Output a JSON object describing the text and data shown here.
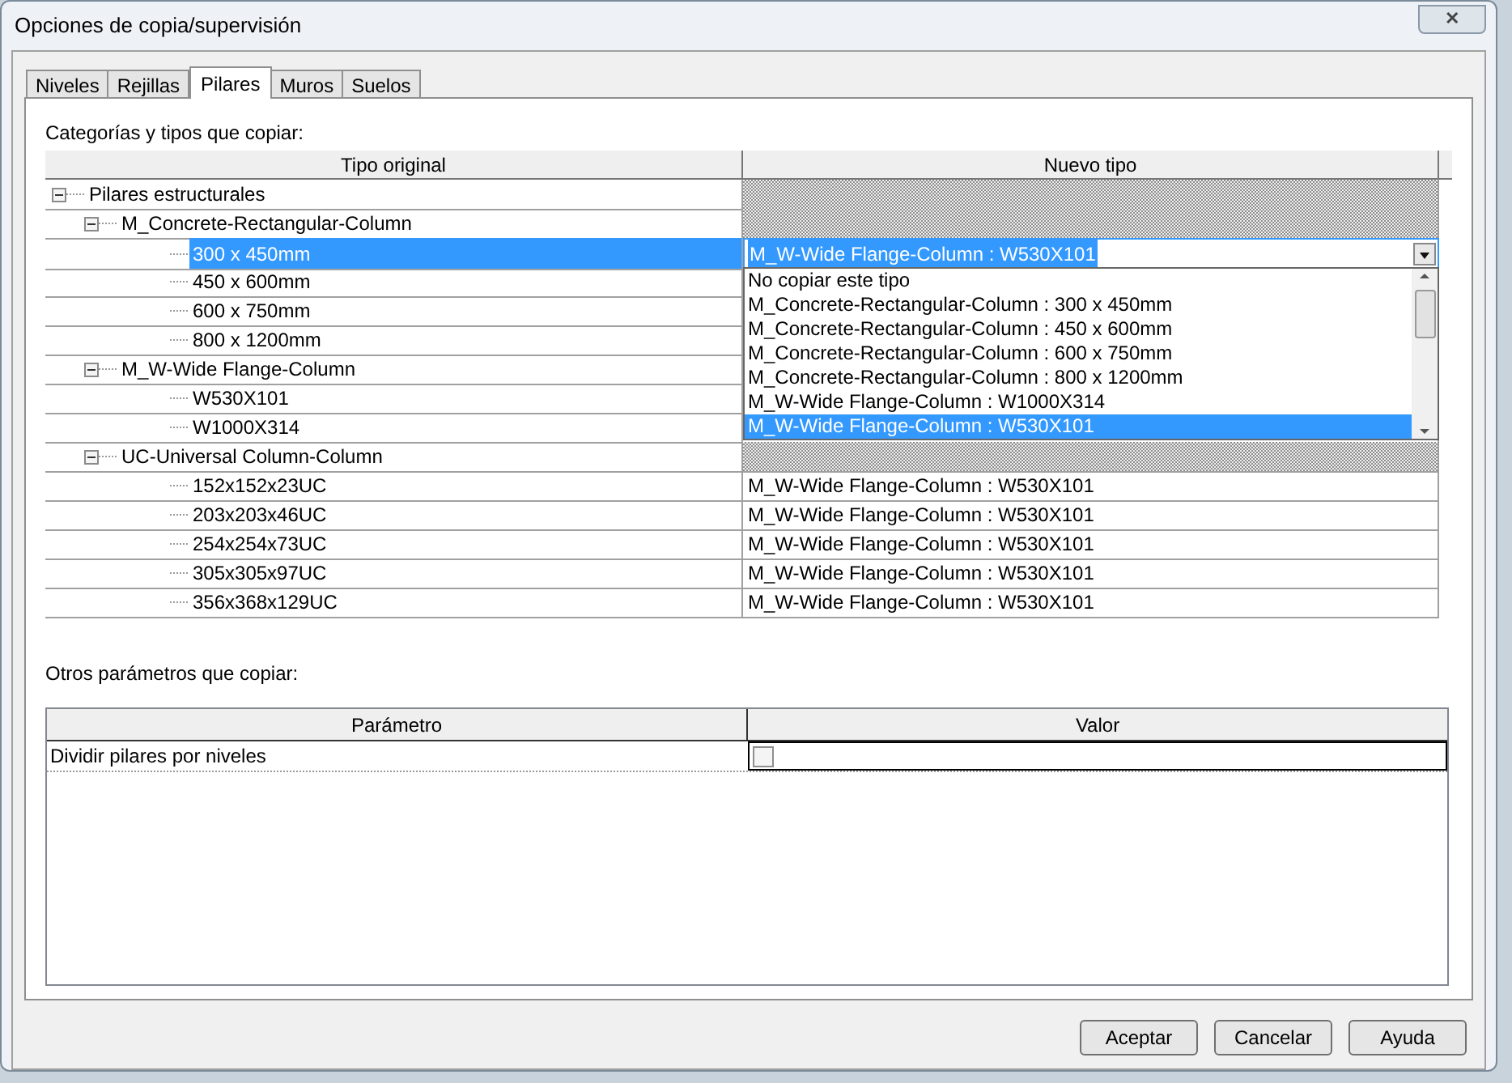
{
  "window": {
    "title": "Opciones de copia/supervisión",
    "close": "✕"
  },
  "tabs": [
    {
      "label": "Niveles",
      "selected": false
    },
    {
      "label": "Rejillas",
      "selected": false
    },
    {
      "label": "Pilares",
      "selected": true
    },
    {
      "label": "Muros",
      "selected": false
    },
    {
      "label": "Suelos",
      "selected": false
    }
  ],
  "types_section": {
    "label": "Categorías y tipos que copiar:",
    "columns": [
      "Tipo original",
      "Nuevo tipo"
    ],
    "tree": [
      {
        "label": "Pilares estructurales",
        "expanded": true,
        "children": [
          {
            "label": "M_Concrete-Rectangular-Column",
            "expanded": true,
            "children": [
              {
                "label": "300 x 450mm",
                "selected": true,
                "dropdown": {
                  "value": "M_W-Wide Flange-Column : W530X101",
                  "options": [
                    {
                      "label": "No copiar este tipo",
                      "selected": false
                    },
                    {
                      "label": "M_Concrete-Rectangular-Column : 300 x 450mm",
                      "selected": false
                    },
                    {
                      "label": "M_Concrete-Rectangular-Column : 450 x 600mm",
                      "selected": false
                    },
                    {
                      "label": "M_Concrete-Rectangular-Column : 600 x 750mm",
                      "selected": false
                    },
                    {
                      "label": "M_Concrete-Rectangular-Column : 800 x 1200mm",
                      "selected": false
                    },
                    {
                      "label": "M_W-Wide Flange-Column : W1000X314",
                      "selected": false
                    },
                    {
                      "label": "M_W-Wide Flange-Column : W530X101",
                      "selected": true
                    }
                  ]
                }
              },
              {
                "label": "450 x 600mm",
                "selected": false
              },
              {
                "label": "600 x 750mm",
                "selected": false
              },
              {
                "label": "800 x 1200mm",
                "selected": false
              }
            ]
          },
          {
            "label": "M_W-Wide Flange-Column",
            "expanded": true,
            "children": [
              {
                "label": "W530X101",
                "selected": false
              },
              {
                "label": "W1000X314",
                "selected": false
              }
            ]
          },
          {
            "label": "UC-Universal Column-Column",
            "expanded": true,
            "children": [
              {
                "label": "152x152x23UC",
                "selected": false,
                "new_type": "M_W-Wide Flange-Column : W530X101"
              },
              {
                "label": "203x203x46UC",
                "selected": false,
                "new_type": "M_W-Wide Flange-Column : W530X101"
              },
              {
                "label": "254x254x73UC",
                "selected": false,
                "new_type": "M_W-Wide Flange-Column : W530X101"
              },
              {
                "label": "305x305x97UC",
                "selected": false,
                "new_type": "M_W-Wide Flange-Column : W530X101"
              },
              {
                "label": "356x368x129UC",
                "selected": false,
                "new_type": "M_W-Wide Flange-Column : W530X101"
              }
            ]
          }
        ]
      }
    ]
  },
  "other_section": {
    "label": "Otros parámetros que copiar:",
    "columns": [
      "Parámetro",
      "Valor"
    ],
    "rows": [
      {
        "parameter": "Dividir pilares por niveles",
        "checked": false
      }
    ]
  },
  "buttons": [
    "Aceptar",
    "Cancelar",
    "Ayuda"
  ]
}
